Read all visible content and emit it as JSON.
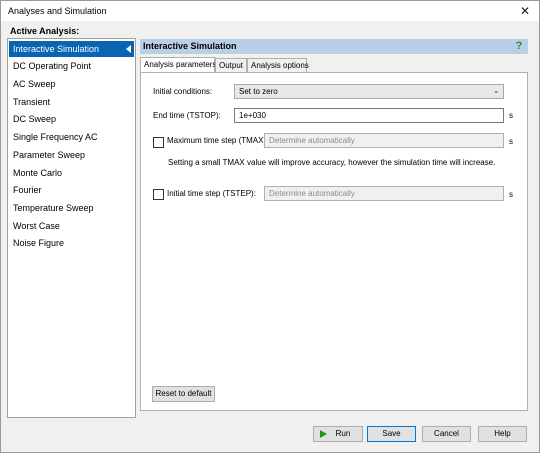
{
  "window": {
    "title": "Analyses and Simulation",
    "close_glyph": "✕"
  },
  "active_analysis_label": "Active Analysis:",
  "analyses": [
    {
      "label": "Interactive Simulation",
      "selected": true
    },
    {
      "label": "DC Operating Point"
    },
    {
      "label": "AC Sweep"
    },
    {
      "label": "Transient"
    },
    {
      "label": "DC Sweep"
    },
    {
      "label": "Single Frequency AC"
    },
    {
      "label": "Parameter Sweep"
    },
    {
      "label": "Monte Carlo"
    },
    {
      "label": "Fourier"
    },
    {
      "label": "Temperature Sweep"
    },
    {
      "label": "Worst Case"
    },
    {
      "label": "Noise Figure"
    }
  ],
  "panel": {
    "title": "Interactive Simulation",
    "help_glyph": "?"
  },
  "tabs": {
    "analysis_parameters": "Analysis parameters",
    "output": "Output",
    "analysis_options": "Analysis options"
  },
  "form": {
    "initial_conditions": {
      "label": "Initial conditions:",
      "value": "Set to zero",
      "arrow": "⌄"
    },
    "end_time": {
      "label": "End time (TSTOP):",
      "value": "1e+030",
      "unit": "s"
    },
    "tmax": {
      "label": "Maximum time step (TMAX):",
      "placeholder": "Determine automatically",
      "unit": "s",
      "checked": false
    },
    "note": "Setting a small TMAX value will improve accuracy, however the simulation time will increase.",
    "tstep": {
      "label": "Initial time step (TSTEP):",
      "placeholder": "Determine automatically",
      "unit": "s",
      "checked": false
    },
    "reset_label": "Reset to default"
  },
  "footer": {
    "run_label": "Run",
    "save_label": "Save",
    "cancel_label": "Cancel",
    "help_label": "Help"
  },
  "colors": {
    "selection": "#0a64b4",
    "header": "#b9cfe6",
    "run_icon": "#1a9a1a",
    "help_icon": "#2e8b2e"
  }
}
